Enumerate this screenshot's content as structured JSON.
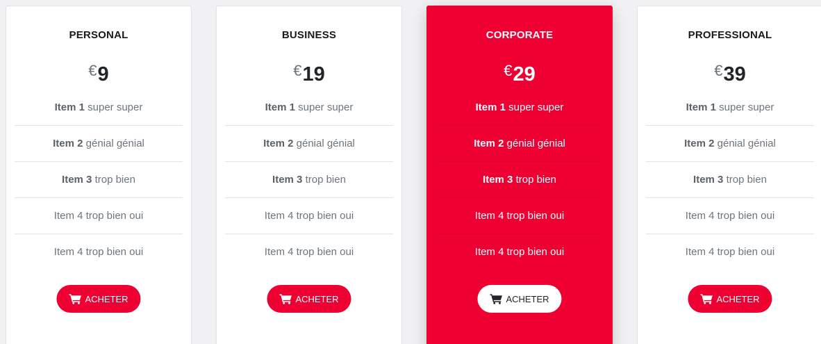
{
  "currency_symbol": "€",
  "colors": {
    "accent": "#ee0033",
    "card_bg": "#ffffff",
    "page_bg": "#f1f1f3",
    "muted_text": "#6c757d"
  },
  "plans": [
    {
      "name": "PERSONAL",
      "price": "9",
      "featured": false,
      "features": [
        {
          "bold": "Item 1",
          "text": " super super"
        },
        {
          "bold": "Item 2",
          "text": " génial génial"
        },
        {
          "bold": "Item 3",
          "text": " trop bien"
        },
        {
          "bold": "",
          "text": "Item 4 trop bien oui"
        },
        {
          "bold": "",
          "text": "Item 4 trop bien oui"
        }
      ],
      "button_label": "ACHETER",
      "button_icon": "shopping-cart-icon"
    },
    {
      "name": "BUSINESS",
      "price": "19",
      "featured": false,
      "features": [
        {
          "bold": "Item 1",
          "text": " super super"
        },
        {
          "bold": "Item 2",
          "text": " génial génial"
        },
        {
          "bold": "Item 3",
          "text": " trop bien"
        },
        {
          "bold": "",
          "text": "Item 4 trop bien oui"
        },
        {
          "bold": "",
          "text": "Item 4 trop bien oui"
        }
      ],
      "button_label": "ACHETER",
      "button_icon": "shopping-cart-icon"
    },
    {
      "name": "CORPORATE",
      "price": "29",
      "featured": true,
      "features": [
        {
          "bold": "Item 1",
          "text": " super super"
        },
        {
          "bold": "Item 2",
          "text": " génial génial"
        },
        {
          "bold": "Item 3",
          "text": " trop bien"
        },
        {
          "bold": "",
          "text": "Item 4 trop bien oui"
        },
        {
          "bold": "",
          "text": "Item 4 trop bien oui"
        }
      ],
      "button_label": "ACHETER",
      "button_icon": "shopping-cart-icon"
    },
    {
      "name": "PROFESSIONAL",
      "price": "39",
      "featured": false,
      "features": [
        {
          "bold": "Item 1",
          "text": " super super"
        },
        {
          "bold": "Item 2",
          "text": " génial génial"
        },
        {
          "bold": "Item 3",
          "text": " trop bien"
        },
        {
          "bold": "",
          "text": "Item 4 trop bien oui"
        },
        {
          "bold": "",
          "text": "Item 4 trop bien oui"
        }
      ],
      "button_label": "ACHETER",
      "button_icon": "shopping-cart-icon"
    }
  ]
}
